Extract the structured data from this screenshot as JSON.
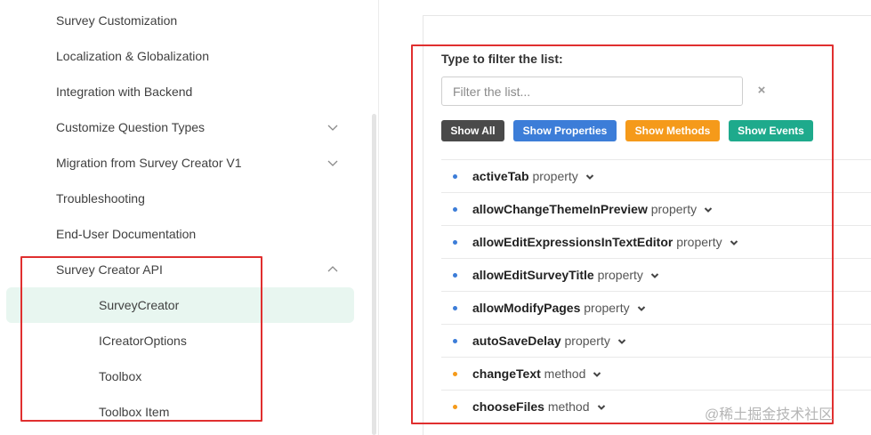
{
  "sidebar": {
    "items": [
      {
        "label": "Survey Customization"
      },
      {
        "label": "Localization & Globalization"
      },
      {
        "label": "Integration with Backend"
      },
      {
        "label": "Customize Question Types"
      },
      {
        "label": "Migration from Survey Creator V1"
      },
      {
        "label": "Troubleshooting"
      },
      {
        "label": "End-User Documentation"
      },
      {
        "label": "Survey Creator API"
      }
    ],
    "subitems": [
      {
        "label": "SurveyCreator"
      },
      {
        "label": "ICreatorOptions"
      },
      {
        "label": "Toolbox"
      },
      {
        "label": "Toolbox Item"
      }
    ]
  },
  "filter": {
    "title": "Type to filter the list:",
    "placeholder": "Filter the list...",
    "value": "",
    "clear_icon": "×"
  },
  "buttons": {
    "show_all": "Show All",
    "show_properties": "Show Properties",
    "show_methods": "Show Methods",
    "show_events": "Show Events"
  },
  "members": [
    {
      "name": "activeTab",
      "kind": "property"
    },
    {
      "name": "allowChangeThemeInPreview",
      "kind": "property"
    },
    {
      "name": "allowEditExpressionsInTextEditor",
      "kind": "property"
    },
    {
      "name": "allowEditSurveyTitle",
      "kind": "property"
    },
    {
      "name": "allowModifyPages",
      "kind": "property"
    },
    {
      "name": "autoSaveDelay",
      "kind": "property"
    },
    {
      "name": "changeText",
      "kind": "method"
    },
    {
      "name": "chooseFiles",
      "kind": "method"
    }
  ],
  "colors": {
    "property_dot": "#3c7dd8",
    "method_dot": "#f59a1a",
    "highlight_box": "#e02f2f",
    "active_item_bg": "#e8f6f0"
  },
  "watermark": "@稀土掘金技术社区"
}
